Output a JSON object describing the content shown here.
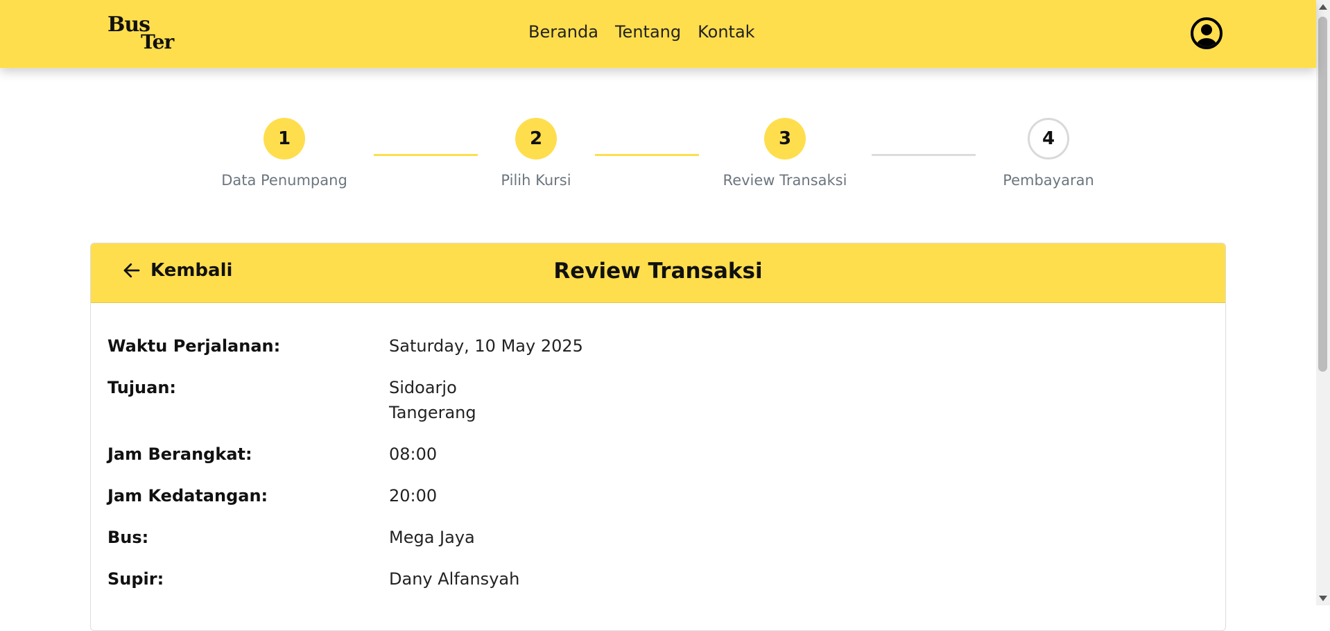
{
  "brand": {
    "logo_line1": "Bus",
    "logo_line2": "Ter"
  },
  "nav": {
    "items": [
      "Beranda",
      "Tentang",
      "Kontak"
    ]
  },
  "colors": {
    "accent": "#FFDE4D",
    "inactive": "#dcdcdc",
    "muted_text": "#6c757d"
  },
  "stepper": {
    "current": 3,
    "steps": [
      {
        "number": "1",
        "label": "Data Penumpang"
      },
      {
        "number": "2",
        "label": "Pilih Kursi"
      },
      {
        "number": "3",
        "label": "Review Transaksi"
      },
      {
        "number": "4",
        "label": "Pembayaran"
      }
    ]
  },
  "card": {
    "back_label": "Kembali",
    "title": "Review Transaksi",
    "details": [
      {
        "label": "Waktu Perjalanan:",
        "value": "Saturday, 10 May 2025"
      },
      {
        "label": "Tujuan:",
        "value_line1": "Sidoarjo",
        "value_line2": "Tangerang"
      },
      {
        "label": "Jam Berangkat:",
        "value": "08:00"
      },
      {
        "label": "Jam Kedatangan:",
        "value": "20:00"
      },
      {
        "label": "Bus:",
        "value": "Mega Jaya"
      },
      {
        "label": "Supir:",
        "value": "Dany Alfansyah"
      }
    ]
  }
}
